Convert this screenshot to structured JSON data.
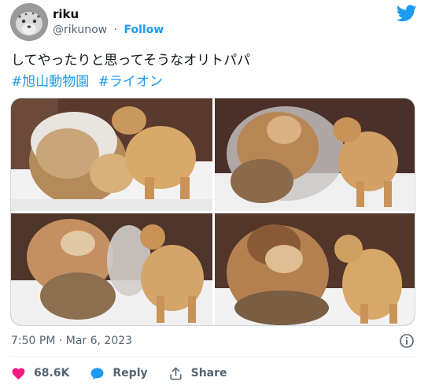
{
  "header": {
    "display_name": "riku",
    "handle": "@rikunow",
    "separator": "·",
    "follow_label": "Follow"
  },
  "tweet": {
    "text": "してやったりと思ってそうなオリトパパ",
    "hashtags": [
      "#旭山動物園",
      "#ライオン"
    ]
  },
  "meta": {
    "timestamp": "7:50 PM · Mar 6, 2023"
  },
  "actions": {
    "like_count": "68.6K",
    "reply_label": "Reply",
    "share_label": "Share"
  },
  "colors": {
    "accent": "#1d9bf0",
    "like": "#f91880",
    "muted": "#536471"
  },
  "icons": [
    "twitter-bird-icon",
    "info-icon",
    "heart-icon",
    "reply-bubble-icon",
    "share-icon"
  ]
}
